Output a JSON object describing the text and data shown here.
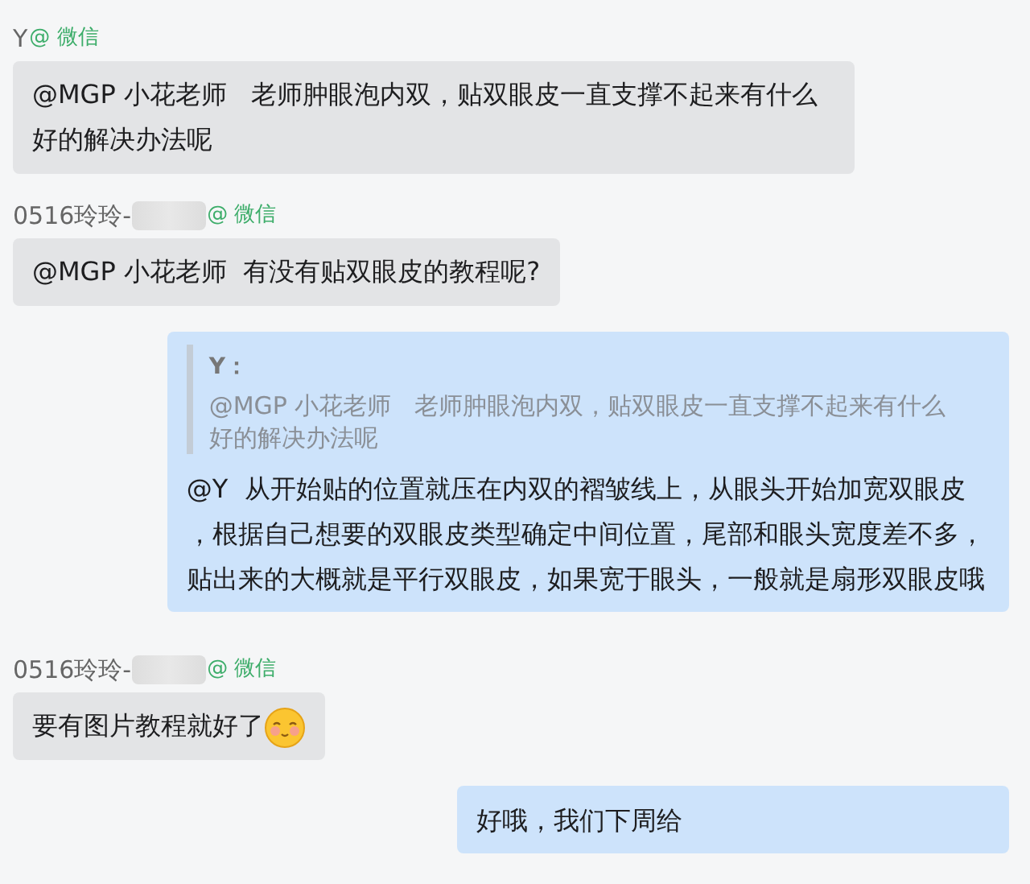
{
  "messages": [
    {
      "kind": "incoming",
      "sender": "Y",
      "redacted": false,
      "source": "@ 微信",
      "text": "@MGP 小花老师   老师肿眼泡内双，贴双眼皮一直支撑不起来有什么好的解决办法呢"
    },
    {
      "kind": "incoming",
      "sender": "0516玲玲-",
      "redacted": true,
      "source": "@ 微信",
      "text": "@MGP 小花老师  有没有贴双眼皮的教程呢?"
    },
    {
      "kind": "outgoing",
      "quote": {
        "sender": "Y：",
        "text": "@MGP 小花老师   老师肿眼泡内双，贴双眼皮一直支撑不起来有什么好的解决办法呢"
      },
      "text": "@Y  从开始贴的位置就压在内双的褶皱线上，从眼头开始加宽双眼皮，根据自己想要的双眼皮类型确定中间位置，尾部和眼头宽度差不多，贴出来的大概就是平行双眼皮，如果宽于眼头，一般就是扇形双眼皮哦"
    },
    {
      "kind": "incoming",
      "sender": "0516玲玲-",
      "redacted": true,
      "source": "@ 微信",
      "text": "要有图片教程就好了",
      "emoji": true
    },
    {
      "kind": "outgoing",
      "text": "好哦，我们下周给"
    }
  ]
}
